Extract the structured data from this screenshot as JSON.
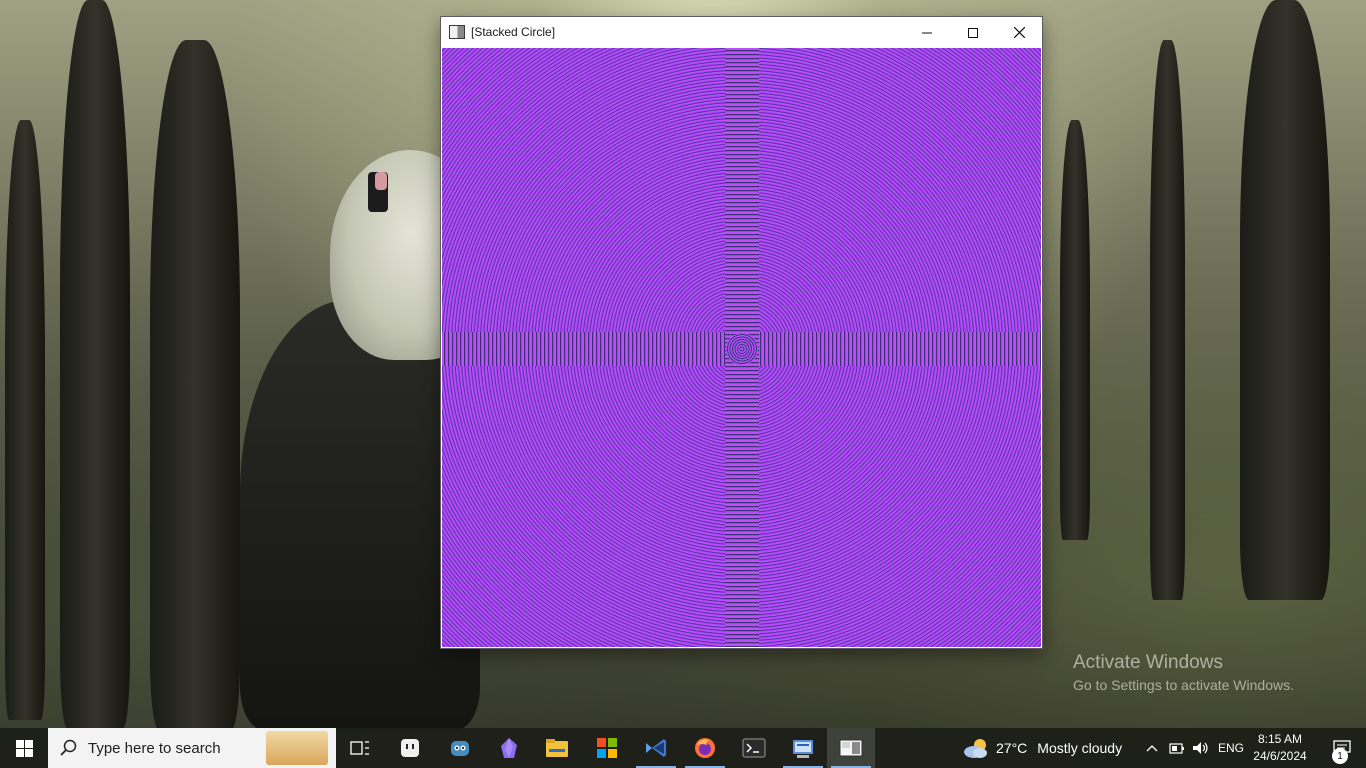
{
  "window": {
    "title": "[Stacked Circle]",
    "canvas_colors": {
      "primary": "#b64df7",
      "secondary": "#2d3a78"
    }
  },
  "watermark": {
    "title": "Activate Windows",
    "subtitle": "Go to Settings to activate Windows."
  },
  "taskbar": {
    "search_placeholder": "Type here to search",
    "pinned": [
      {
        "name": "task-view-icon"
      },
      {
        "name": "app-ghost-icon"
      },
      {
        "name": "godot-icon"
      },
      {
        "name": "obsidian-icon"
      },
      {
        "name": "file-explorer-icon"
      },
      {
        "name": "microsoft-store-icon"
      },
      {
        "name": "visual-studio-icon"
      },
      {
        "name": "firefox-icon"
      },
      {
        "name": "terminal-icon"
      },
      {
        "name": "control-panel-icon"
      },
      {
        "name": "stacked-circle-app-icon"
      }
    ],
    "weather": {
      "temperature": "27°C",
      "condition": "Mostly cloudy"
    },
    "language": "ENG",
    "time": "8:15 AM",
    "date": "24/6/2024",
    "notification_count": "1"
  }
}
